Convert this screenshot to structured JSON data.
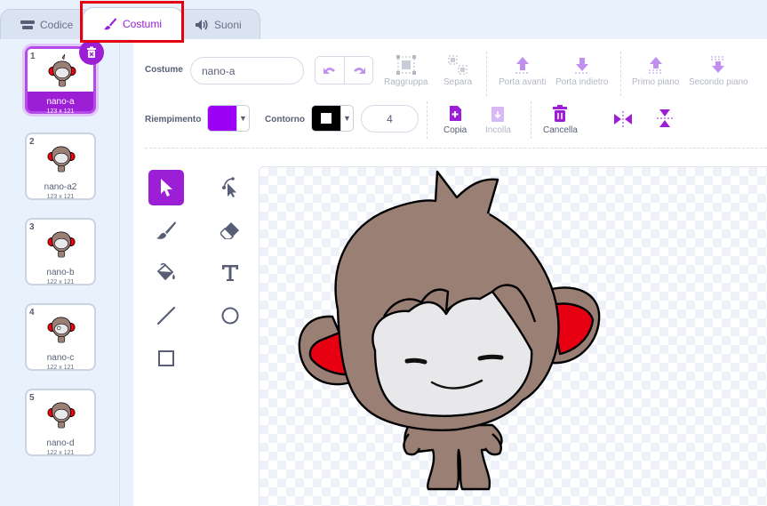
{
  "tabs": [
    {
      "label": "Codice",
      "icon": "code-icon",
      "active": false
    },
    {
      "label": "Costumi",
      "icon": "brush-icon",
      "active": true
    },
    {
      "label": "Suoni",
      "icon": "speaker-icon",
      "active": false
    }
  ],
  "costumes": [
    {
      "num": "1",
      "name": "nano-a",
      "size": "123 x 121",
      "selected": true
    },
    {
      "num": "2",
      "name": "nano-a2",
      "size": "123 x 121",
      "selected": false
    },
    {
      "num": "3",
      "name": "nano-b",
      "size": "122 x 121",
      "selected": false
    },
    {
      "num": "4",
      "name": "nano-c",
      "size": "122 x 121",
      "selected": false
    },
    {
      "num": "5",
      "name": "nano-d",
      "size": "122 x 121",
      "selected": false
    }
  ],
  "toolbar": {
    "costume_label": "Costume",
    "costume_name": "nano-a",
    "group_label": "Raggruppa",
    "ungroup_label": "Separa",
    "forward_label": "Porta avanti",
    "backward_label": "Porta indietro",
    "front_label": "Primo piano",
    "back_label": "Secondo piano",
    "fill_label": "Riempimento",
    "fill_color": "#9c00f5",
    "outline_label": "Contorno",
    "outline_color": "#000000",
    "outline_width": "4",
    "copy_label": "Copia",
    "paste_label": "Incolla",
    "delete_label": "Cancella"
  },
  "drawing_tools": [
    {
      "name": "select-tool",
      "icon": "arrow-icon",
      "active": true
    },
    {
      "name": "reshape-tool",
      "icon": "reshape-icon",
      "active": false
    },
    {
      "name": "brush-tool",
      "icon": "brush-icon",
      "active": false
    },
    {
      "name": "eraser-tool",
      "icon": "eraser-icon",
      "active": false
    },
    {
      "name": "fill-tool",
      "icon": "bucket-icon",
      "active": false
    },
    {
      "name": "text-tool",
      "icon": "text-icon",
      "active": false
    },
    {
      "name": "line-tool",
      "icon": "line-icon",
      "active": false
    },
    {
      "name": "circle-tool",
      "icon": "circle-icon",
      "active": false
    },
    {
      "name": "rectangle-tool",
      "icon": "rectangle-icon",
      "active": false
    }
  ],
  "colors": {
    "accent": "#9c1fd6",
    "highlight": "#e60012",
    "tool_icon": "#575e75",
    "disabled": "#b2b7c4",
    "toolbar_icon": "#c08ff0"
  }
}
